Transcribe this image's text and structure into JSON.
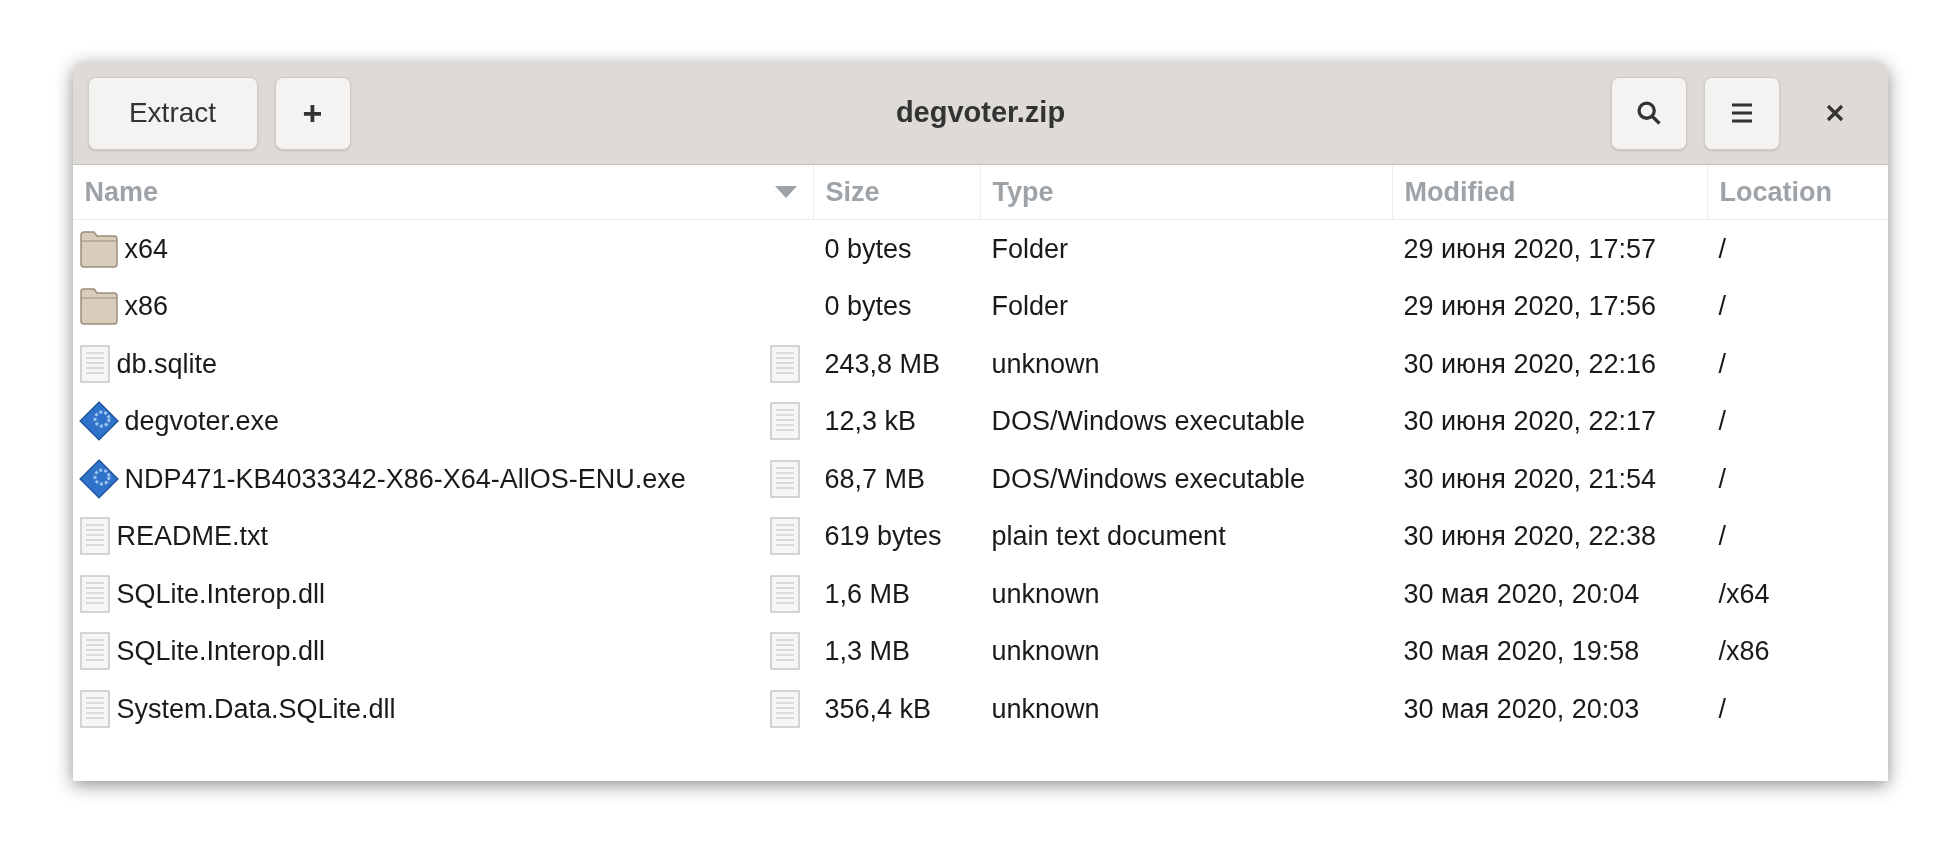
{
  "window": {
    "title": "degvoter.zip"
  },
  "toolbar": {
    "extract_button": "Extract",
    "add_button": "+"
  },
  "table": {
    "columns": [
      "Name",
      "Size",
      "Type",
      "Modified",
      "Location"
    ],
    "rows": [
      {
        "kind": "folder",
        "name": "x64",
        "size": "0 bytes",
        "type": "Folder",
        "modified": "29 июня 2020, 17:57",
        "location": "/"
      },
      {
        "kind": "folder",
        "name": "x86",
        "size": "0 bytes",
        "type": "Folder",
        "modified": "29 июня 2020, 17:56",
        "location": "/"
      },
      {
        "kind": "file",
        "name": "db.sqlite",
        "size": "243,8 MB",
        "type": "unknown",
        "modified": "30 июня 2020, 22:16",
        "location": "/"
      },
      {
        "kind": "executable",
        "name": "degvoter.exe",
        "size": "12,3 kB",
        "type": "DOS/Windows executable",
        "modified": "30 июня 2020, 22:17",
        "location": "/"
      },
      {
        "kind": "executable",
        "name": "NDP471-KB4033342-X86-X64-AllOS-ENU.exe",
        "size": "68,7 MB",
        "type": "DOS/Windows executable",
        "modified": "30 июня 2020, 21:54",
        "location": "/"
      },
      {
        "kind": "file",
        "name": "README.txt",
        "size": "619 bytes",
        "type": "plain text document",
        "modified": "30 июня 2020, 22:38",
        "location": "/"
      },
      {
        "kind": "file",
        "name": "SQLite.Interop.dll",
        "size": "1,6 MB",
        "type": "unknown",
        "modified": "30 мая 2020, 20:04",
        "location": "/x64"
      },
      {
        "kind": "file",
        "name": "SQLite.Interop.dll",
        "size": "1,3 MB",
        "type": "unknown",
        "modified": "30 мая 2020, 19:58",
        "location": "/x86"
      },
      {
        "kind": "file",
        "name": "System.Data.SQLite.dll",
        "size": "356,4 kB",
        "type": "unknown",
        "modified": "30 мая 2020, 20:03",
        "location": "/"
      }
    ]
  }
}
